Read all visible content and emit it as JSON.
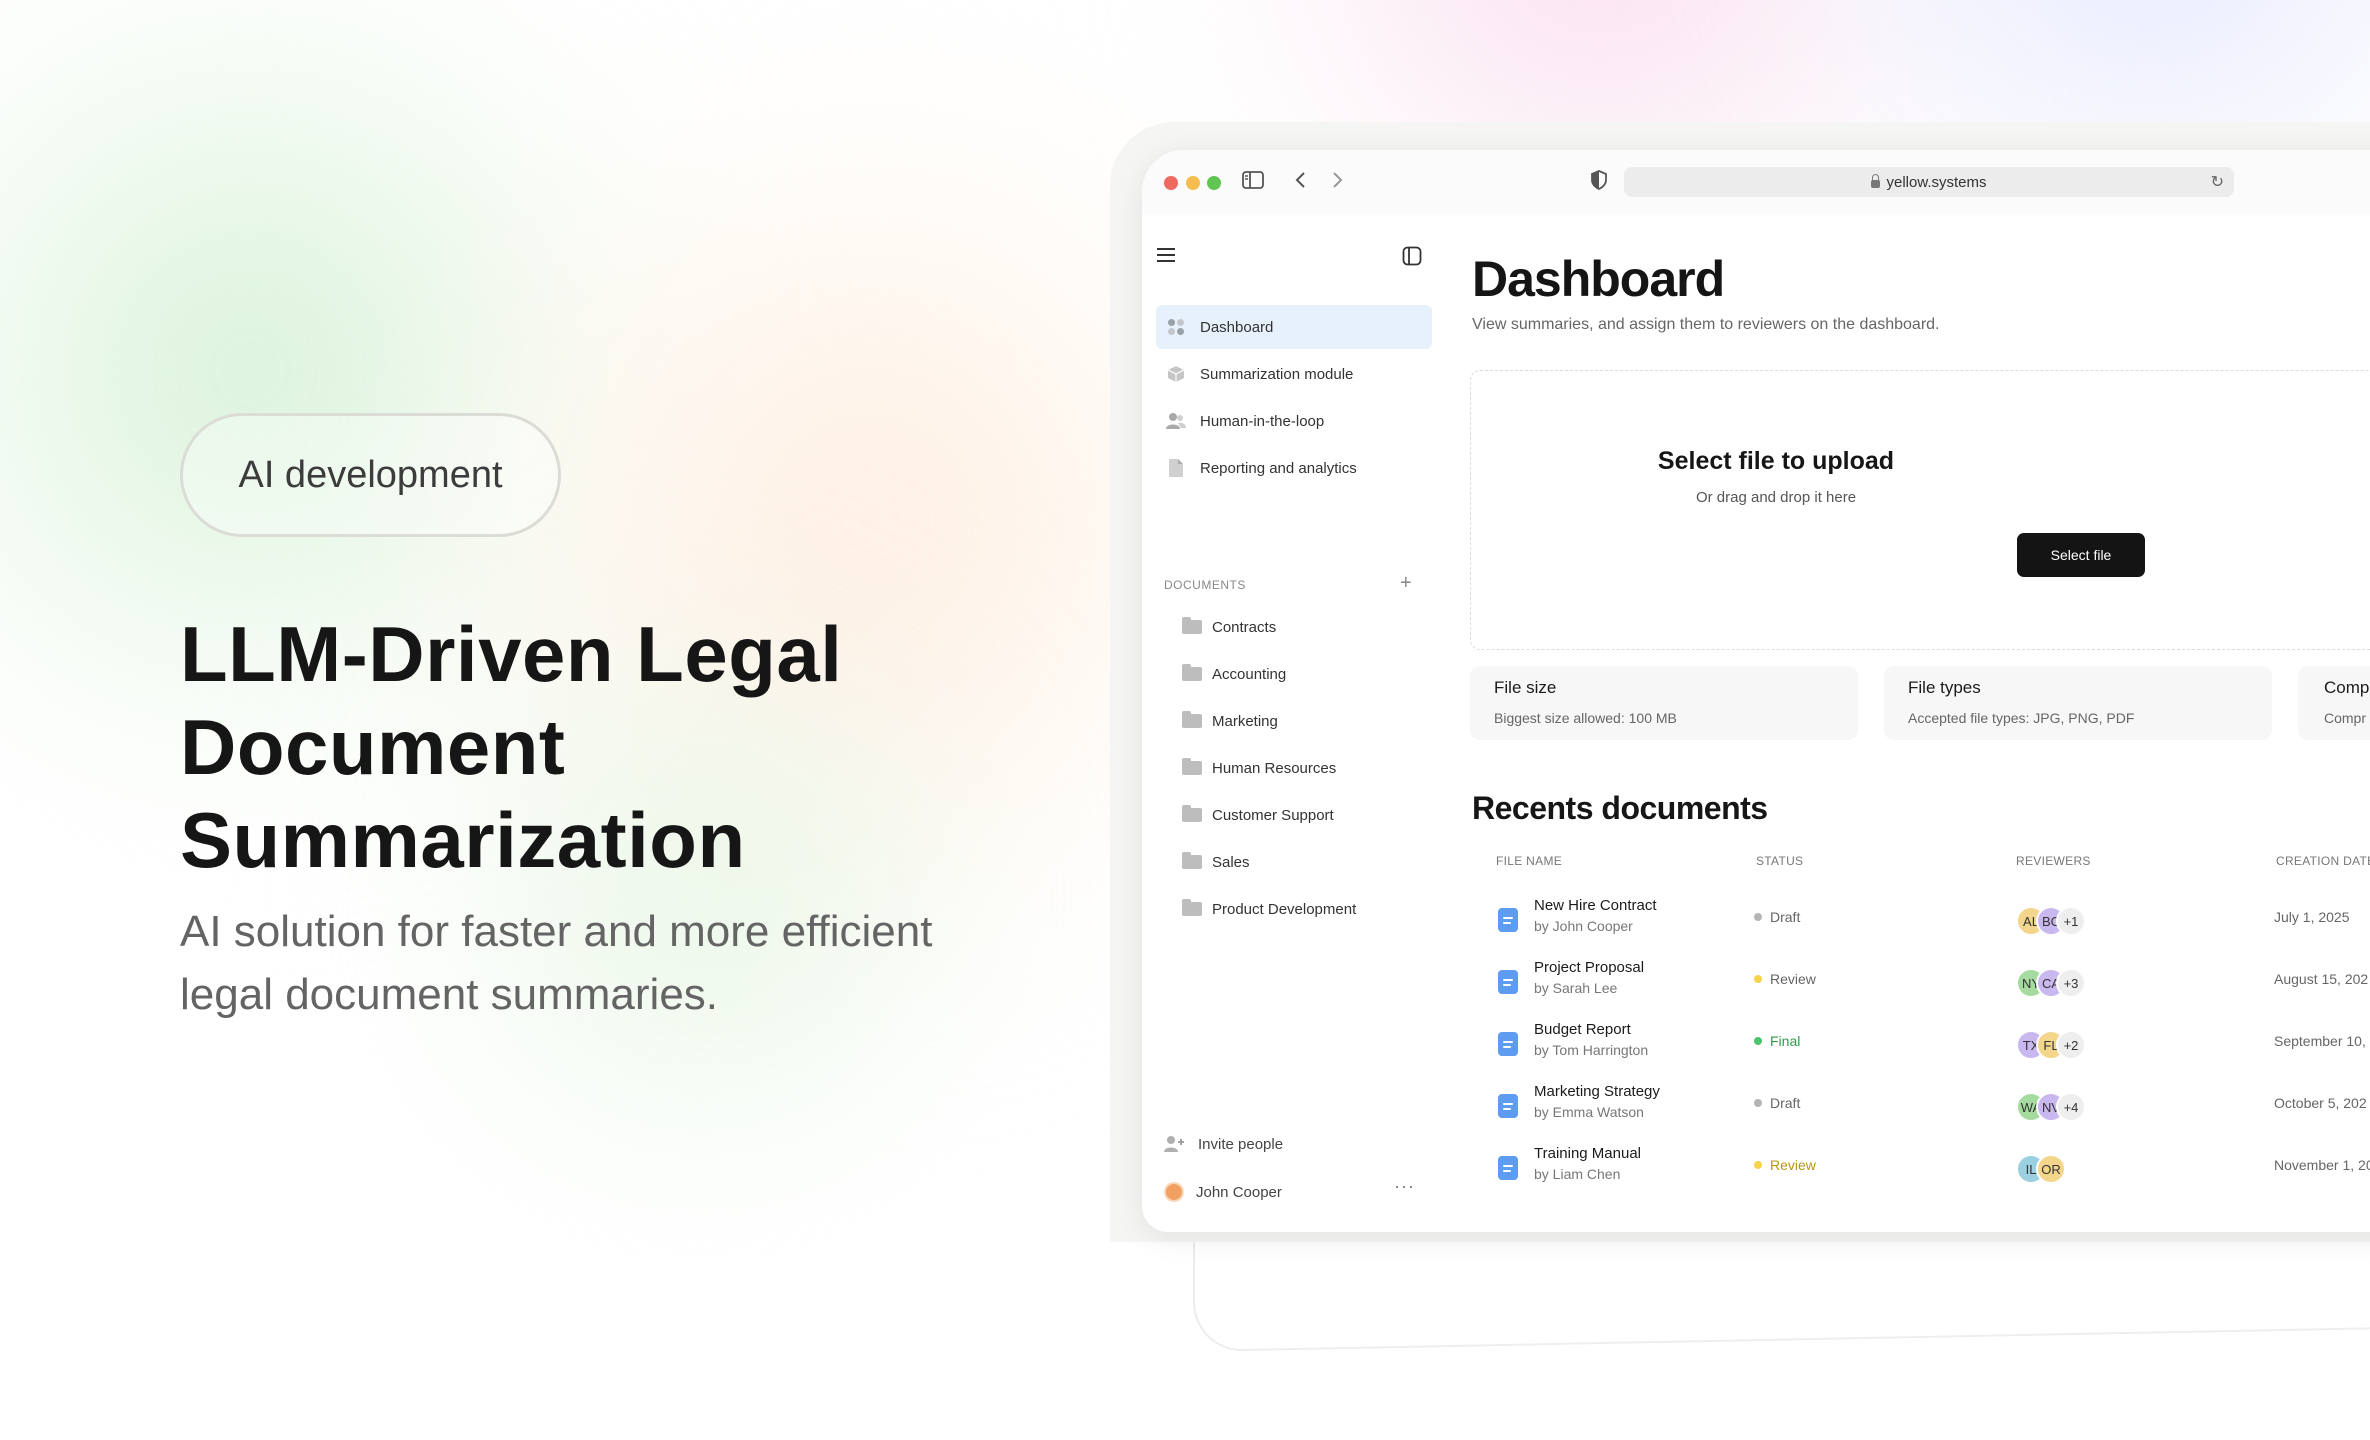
{
  "hero": {
    "tag": "AI development",
    "title": "LLM-Driven Legal Document Summarization",
    "subtitle": "AI solution for faster and more efficient legal document summaries."
  },
  "browser": {
    "url": "yellow.systems",
    "lock_icon": "lock-icon",
    "reload_icon": "reload-icon"
  },
  "sidebar": {
    "nav": [
      {
        "label": "Dashboard",
        "icon": "dashboard-icon",
        "active": true
      },
      {
        "label": "Summarization module",
        "icon": "cube-icon"
      },
      {
        "label": "Human-in-the-loop",
        "icon": "people-icon"
      },
      {
        "label": "Reporting and analytics",
        "icon": "file-icon"
      }
    ],
    "documents_label": "DOCUMENTS",
    "folders": [
      "Contracts",
      "Accounting",
      "Marketing",
      "Human Resources",
      "Customer Support",
      "Sales",
      "Product Development"
    ],
    "invite_label": "Invite people",
    "user_name": "John Cooper"
  },
  "main": {
    "title": "Dashboard",
    "description": "View summaries, and assign them to reviewers on the dashboard.",
    "upload": {
      "title": "Select file to upload",
      "subtitle": "Or drag and drop it  here",
      "button": "Select file"
    },
    "cards": [
      {
        "title": "File size",
        "desc": "Biggest size allowed: 100 MB"
      },
      {
        "title": "File types",
        "desc": "Accepted file types: JPG, PNG, PDF"
      },
      {
        "title": "Comp",
        "desc": "Compr"
      }
    ],
    "recents_title": "Recents documents",
    "columns": [
      "FILE NAME",
      "STATUS",
      "REVIEWERS",
      "CREATION DATE"
    ],
    "rows": [
      {
        "name": "New Hire Contract",
        "by": "by John Cooper",
        "status": "Draft",
        "reviewers": [
          "AL",
          "BC"
        ],
        "extra": "+1",
        "date": "July 1, 2025"
      },
      {
        "name": "Project Proposal",
        "by": "by Sarah Lee",
        "status": "Review",
        "reviewers": [
          "NY",
          "CA"
        ],
        "extra": "+3",
        "date": "August 15, 202"
      },
      {
        "name": "Budget Report",
        "by": "by Tom Harrington",
        "status": "Final",
        "reviewers": [
          "TX",
          "FL"
        ],
        "extra": "+2",
        "date": "September 10,"
      },
      {
        "name": "Marketing Strategy",
        "by": "by Emma Watson",
        "status": "Draft",
        "reviewers": [
          "WA",
          "NV"
        ],
        "extra": "+4",
        "date": "October 5, 202"
      },
      {
        "name": "Training Manual",
        "by": "by Liam Chen",
        "status": "Review",
        "reviewers": [
          "IL",
          "OR"
        ],
        "extra": "",
        "date": "November 1, 20"
      }
    ]
  },
  "colors": {
    "status_draft": "#b5b5b5",
    "status_review": "#f5d34a",
    "status_final": "#4cc46a",
    "avatar_a": "#f4d58c",
    "avatar_b": "#c9b8f0",
    "avatar_c": "#a6dba0",
    "avatar_d": "#9ad0e0",
    "avatar_extra": "#eeeeee"
  }
}
